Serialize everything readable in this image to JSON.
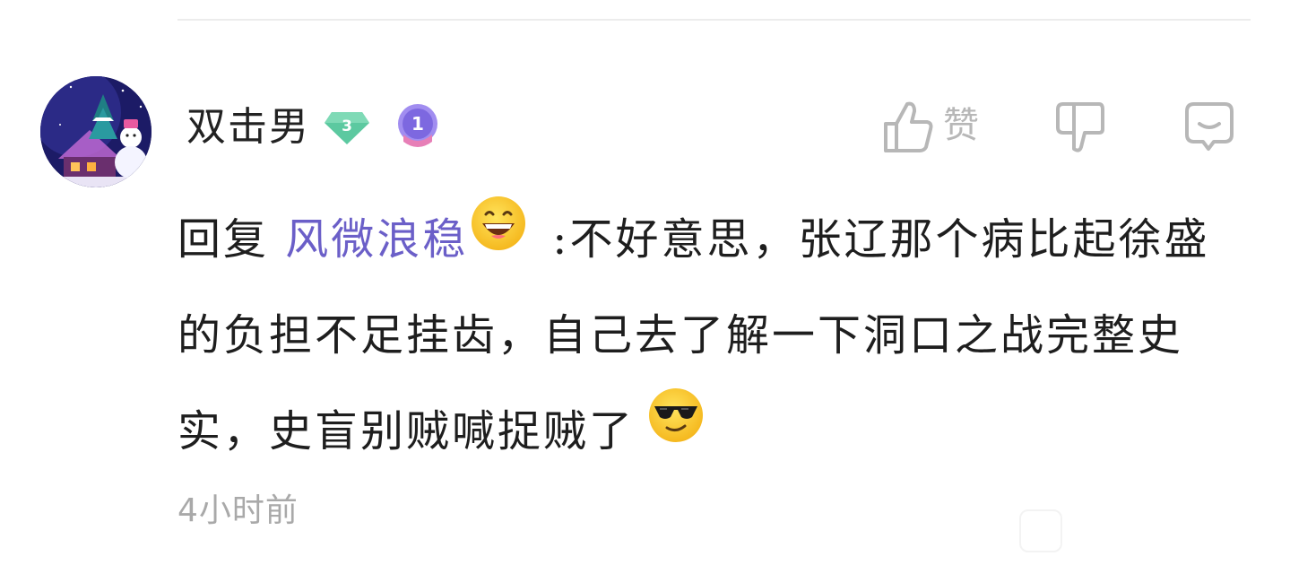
{
  "comment": {
    "username": "双击男",
    "level": "3",
    "medal_rank": "1",
    "actions": {
      "like_label": "赞"
    },
    "body": {
      "reply_prefix": "回复 ",
      "reply_target": "风微浪稳",
      "text": ":不好意思，张辽那个病比起徐盛的负担不足挂齿，自己去了解一下洞口之战完整史实，史盲别贼喊捉贼了"
    },
    "timestamp": "4小时前"
  },
  "colors": {
    "reply_target": "#6b5fc8",
    "level_badge": "#5cc9a0",
    "medal_badge": "#8f7be8",
    "icon_gray": "#b7b7b7",
    "timestamp": "#a9a9a9"
  },
  "icons": {
    "like": "thumbs-up-icon",
    "dislike": "thumbs-down-icon",
    "reply": "reply-bubble-icon",
    "emoji_1": "grinning-emoji-icon",
    "emoji_2": "sunglasses-emoji-icon"
  }
}
